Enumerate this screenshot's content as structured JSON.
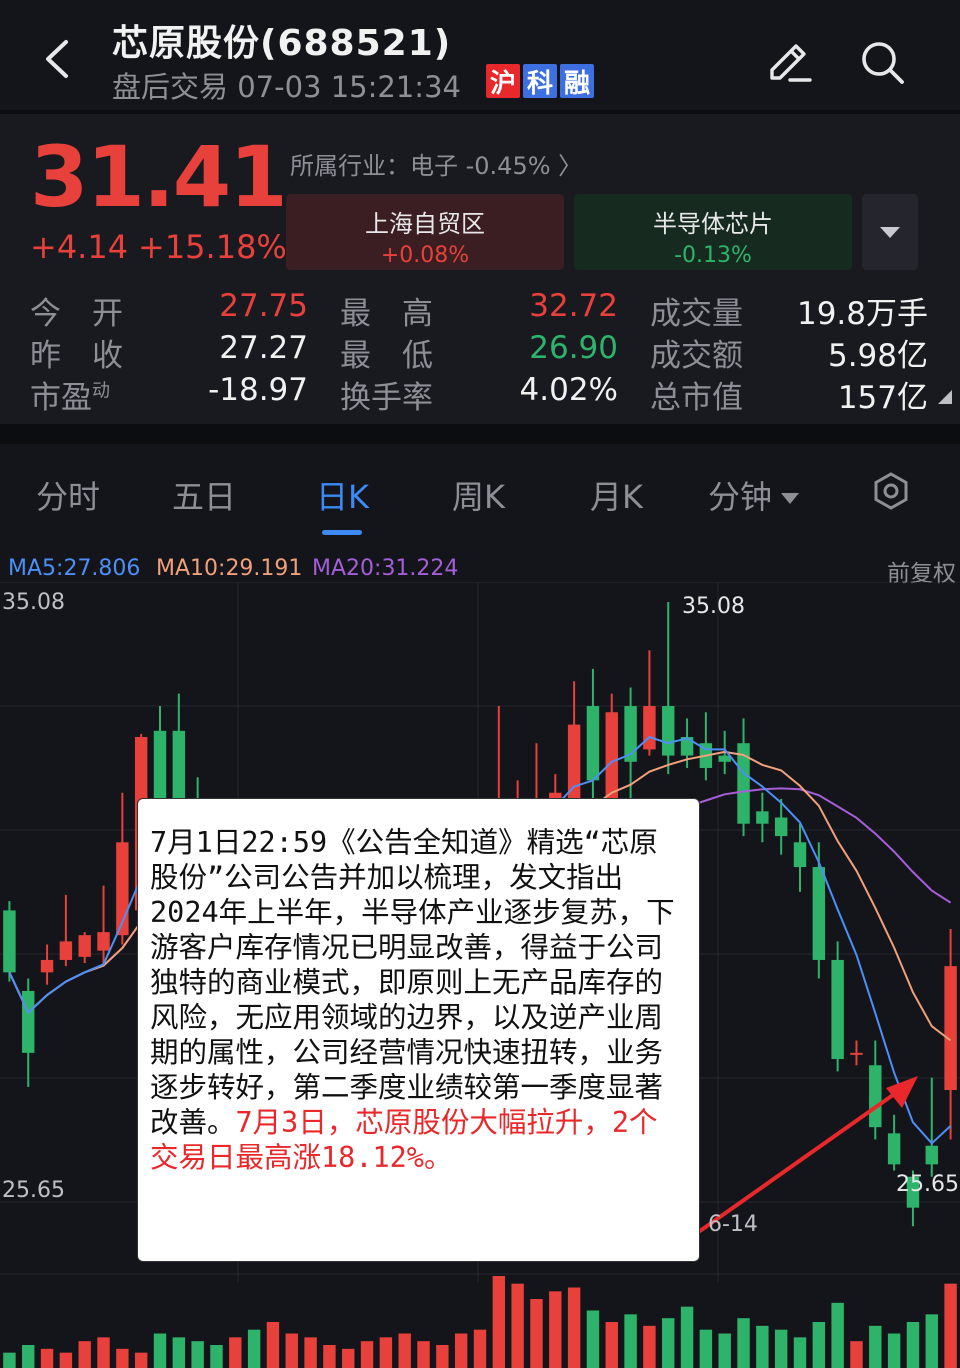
{
  "header": {
    "title": "芯原股份(688521)",
    "session": "盘后交易",
    "datetime": "07-03 15:21:34",
    "tags": [
      {
        "label": "沪",
        "color": "#e8282a"
      },
      {
        "label": "科",
        "color": "#3d6fe0"
      },
      {
        "label": "融",
        "color": "#3d6fe0"
      }
    ]
  },
  "quote": {
    "price": "31.41",
    "change": "+4.14",
    "change_pct": "+15.18%",
    "industry": "所属行业：电子 -0.45% 〉",
    "concepts": [
      {
        "name": "上海自贸区",
        "value": "+0.08%",
        "color": "#e8403a",
        "bg": "#3a1e21"
      },
      {
        "name": "半导体芯片",
        "value": "-0.13%",
        "color": "#2db46a",
        "bg": "#172a20"
      }
    ],
    "stats": {
      "open_label": "今　开",
      "open": "27.75",
      "prev_close_label": "昨　收",
      "prev_close": "27.27",
      "pe_label": "市盈",
      "pe_sup": "动",
      "pe": "-18.97",
      "high_label": "最　高",
      "high": "32.72",
      "low_label": "最　低",
      "low": "26.90",
      "turnover_rate_label": "换手率",
      "turnover_rate": "4.02%",
      "volume_label": "成交量",
      "volume": "19.8万手",
      "amount_label": "成交额",
      "amount": "5.98亿",
      "mktcap_label": "总市值",
      "mktcap": "157亿"
    }
  },
  "tabs": [
    "分时",
    "五日",
    "日K",
    "周K",
    "月K",
    "分钟"
  ],
  "active_tab": "日K",
  "chart": {
    "ma5": "MA5:27.806",
    "ma10": "MA10:29.191",
    "ma20": "MA20:31.224",
    "adjust": "前复权",
    "axis_top": "35.08",
    "axis_bottom": "25.65",
    "high_mark": "35.08",
    "low_mark": "25.65",
    "date_label": "6-14",
    "colors": {
      "up": "#e8403a",
      "down": "#2db46a",
      "ma5": "#4d8ff5",
      "ma10": "#f0a07a",
      "ma20": "#a45fd8"
    }
  },
  "annotation": {
    "text": "7月1日22:59《公告全知道》精选“芯原股份”公司公告并加以梳理，发文指出2024年上半年，半导体产业逐步复苏，下游客户库存情况已明显改善，得益于公司独特的商业模式，即原则上无产品库存的风险，无应用领域的边界，以及逆产业周期的属性，公司经营情况快速扭转，业务逐步转好，第二季度业绩较第一季度显著改善。",
    "highlight": "7月3日，芯原股份大幅拉升，2个交易日最高涨18.12%。"
  },
  "chart_data": {
    "type": "candlestick",
    "ylim": [
      25.65,
      35.08
    ],
    "moving_averages": {
      "MA5": 27.806,
      "MA10": 29.191,
      "MA20": 31.224
    },
    "candles": [
      {
        "o": 30.1,
        "c": 29.1,
        "h": 30.25,
        "l": 28.95,
        "up": false
      },
      {
        "o": 28.8,
        "c": 27.8,
        "h": 29.0,
        "l": 27.25,
        "up": false
      },
      {
        "o": 29.1,
        "c": 29.3,
        "h": 29.55,
        "l": 28.9,
        "up": true
      },
      {
        "o": 29.3,
        "c": 29.6,
        "h": 30.35,
        "l": 29.2,
        "up": true
      },
      {
        "o": 29.35,
        "c": 29.7,
        "h": 29.75,
        "l": 29.25,
        "up": true
      },
      {
        "o": 29.45,
        "c": 29.75,
        "h": 30.5,
        "l": 29.2,
        "up": true
      },
      {
        "o": 29.7,
        "c": 31.2,
        "h": 32.0,
        "l": 29.55,
        "up": true
      },
      {
        "o": 30.1,
        "c": 32.9,
        "h": 32.95,
        "l": 30.0,
        "up": true
      },
      {
        "o": 33.0,
        "c": 31.6,
        "h": 33.4,
        "l": 31.3,
        "up": false
      },
      {
        "o": 33.0,
        "c": 31.8,
        "h": 33.6,
        "l": 31.5,
        "up": false
      },
      {
        "o": 31.8,
        "c": 30.7,
        "h": 32.25,
        "l": 30.6,
        "up": false
      },
      {
        "o": 31.0,
        "c": 30.55,
        "h": 31.6,
        "l": 30.3,
        "up": false
      },
      {
        "o": 30.5,
        "c": 30.6,
        "h": 31.2,
        "l": 30.2,
        "up": true
      },
      {
        "o": 30.4,
        "c": 30.2,
        "h": 30.7,
        "l": 29.9,
        "up": false
      },
      {
        "o": 30.0,
        "c": 30.1,
        "h": 30.5,
        "l": 29.7,
        "up": true
      },
      {
        "o": 30.1,
        "c": 30.2,
        "h": 30.4,
        "l": 29.8,
        "up": true
      },
      {
        "o": 30.2,
        "c": 30.3,
        "h": 30.5,
        "l": 29.9,
        "up": true
      },
      {
        "o": 30.3,
        "c": 30.4,
        "h": 30.6,
        "l": 30.1,
        "up": true
      },
      {
        "o": 30.4,
        "c": 30.5,
        "h": 30.8,
        "l": 30.2,
        "up": true
      },
      {
        "o": 30.5,
        "c": 30.6,
        "h": 30.9,
        "l": 30.3,
        "up": true
      },
      {
        "o": 30.6,
        "c": 30.8,
        "h": 31.1,
        "l": 30.4,
        "up": true
      },
      {
        "o": 30.8,
        "c": 31.0,
        "h": 31.3,
        "l": 30.6,
        "up": true
      },
      {
        "o": 31.0,
        "c": 31.1,
        "h": 31.4,
        "l": 30.8,
        "up": true
      },
      {
        "o": 31.1,
        "c": 31.2,
        "h": 31.5,
        "l": 30.9,
        "up": true
      },
      {
        "o": 31.2,
        "c": 31.3,
        "h": 31.6,
        "l": 31.0,
        "up": true
      },
      {
        "o": 31.3,
        "c": 31.5,
        "h": 31.8,
        "l": 31.1,
        "up": true
      },
      {
        "o": 31.5,
        "c": 31.7,
        "h": 33.4,
        "l": 31.3,
        "up": true
      },
      {
        "o": 31.6,
        "c": 31.8,
        "h": 32.2,
        "l": 31.2,
        "up": true
      },
      {
        "o": 31.8,
        "c": 31.9,
        "h": 32.8,
        "l": 31.7,
        "up": true
      },
      {
        "o": 31.4,
        "c": 32.0,
        "h": 32.3,
        "l": 31.2,
        "up": true
      },
      {
        "o": 31.2,
        "c": 33.1,
        "h": 33.8,
        "l": 30.8,
        "up": true
      },
      {
        "o": 33.4,
        "c": 32.2,
        "h": 34.0,
        "l": 31.8,
        "up": false
      },
      {
        "o": 31.8,
        "c": 33.3,
        "h": 33.6,
        "l": 31.5,
        "up": true
      },
      {
        "o": 33.4,
        "c": 32.5,
        "h": 33.7,
        "l": 31.9,
        "up": false
      },
      {
        "o": 32.7,
        "c": 33.4,
        "h": 34.3,
        "l": 32.6,
        "up": true
      },
      {
        "o": 33.4,
        "c": 32.6,
        "h": 35.08,
        "l": 32.3,
        "up": false
      },
      {
        "o": 32.9,
        "c": 32.6,
        "h": 33.2,
        "l": 32.4,
        "up": false
      },
      {
        "o": 32.8,
        "c": 32.4,
        "h": 33.3,
        "l": 32.2,
        "up": false
      },
      {
        "o": 32.6,
        "c": 32.5,
        "h": 33.0,
        "l": 32.3,
        "up": false
      },
      {
        "o": 32.8,
        "c": 31.5,
        "h": 33.2,
        "l": 31.3,
        "up": false
      },
      {
        "o": 31.7,
        "c": 31.5,
        "h": 32.0,
        "l": 31.2,
        "up": false
      },
      {
        "o": 31.6,
        "c": 31.3,
        "h": 31.9,
        "l": 31.0,
        "up": false
      },
      {
        "o": 31.2,
        "c": 30.8,
        "h": 31.5,
        "l": 30.4,
        "up": false
      },
      {
        "o": 30.8,
        "c": 29.3,
        "h": 31.2,
        "l": 29.0,
        "up": false
      },
      {
        "o": 29.3,
        "c": 27.7,
        "h": 29.6,
        "l": 27.5,
        "up": false
      },
      {
        "o": 27.8,
        "c": 27.8,
        "h": 28.0,
        "l": 27.6,
        "up": true
      },
      {
        "o": 27.6,
        "c": 26.6,
        "h": 28.0,
        "l": 26.4,
        "up": false
      },
      {
        "o": 26.5,
        "c": 26.0,
        "h": 26.8,
        "l": 25.9,
        "up": false
      },
      {
        "o": 25.8,
        "c": 25.3,
        "h": 25.9,
        "l": 25.0,
        "up": false
      },
      {
        "o": 26.3,
        "c": 26.0,
        "h": 27.4,
        "l": 25.8,
        "up": false
      },
      {
        "o": 27.2,
        "c": 29.2,
        "h": 29.8,
        "l": 26.4,
        "up": true
      }
    ],
    "volume": [
      4,
      6,
      5,
      4,
      7,
      8,
      5,
      4,
      9,
      8,
      7,
      6,
      8,
      10,
      12,
      9,
      8,
      6,
      5,
      7,
      8,
      9,
      7,
      6,
      9,
      10,
      24,
      22,
      18,
      20,
      21,
      15,
      12,
      14,
      11,
      13,
      16,
      10,
      9,
      13,
      11,
      10,
      8,
      12,
      17,
      7,
      11,
      9,
      12,
      14,
      22
    ]
  }
}
